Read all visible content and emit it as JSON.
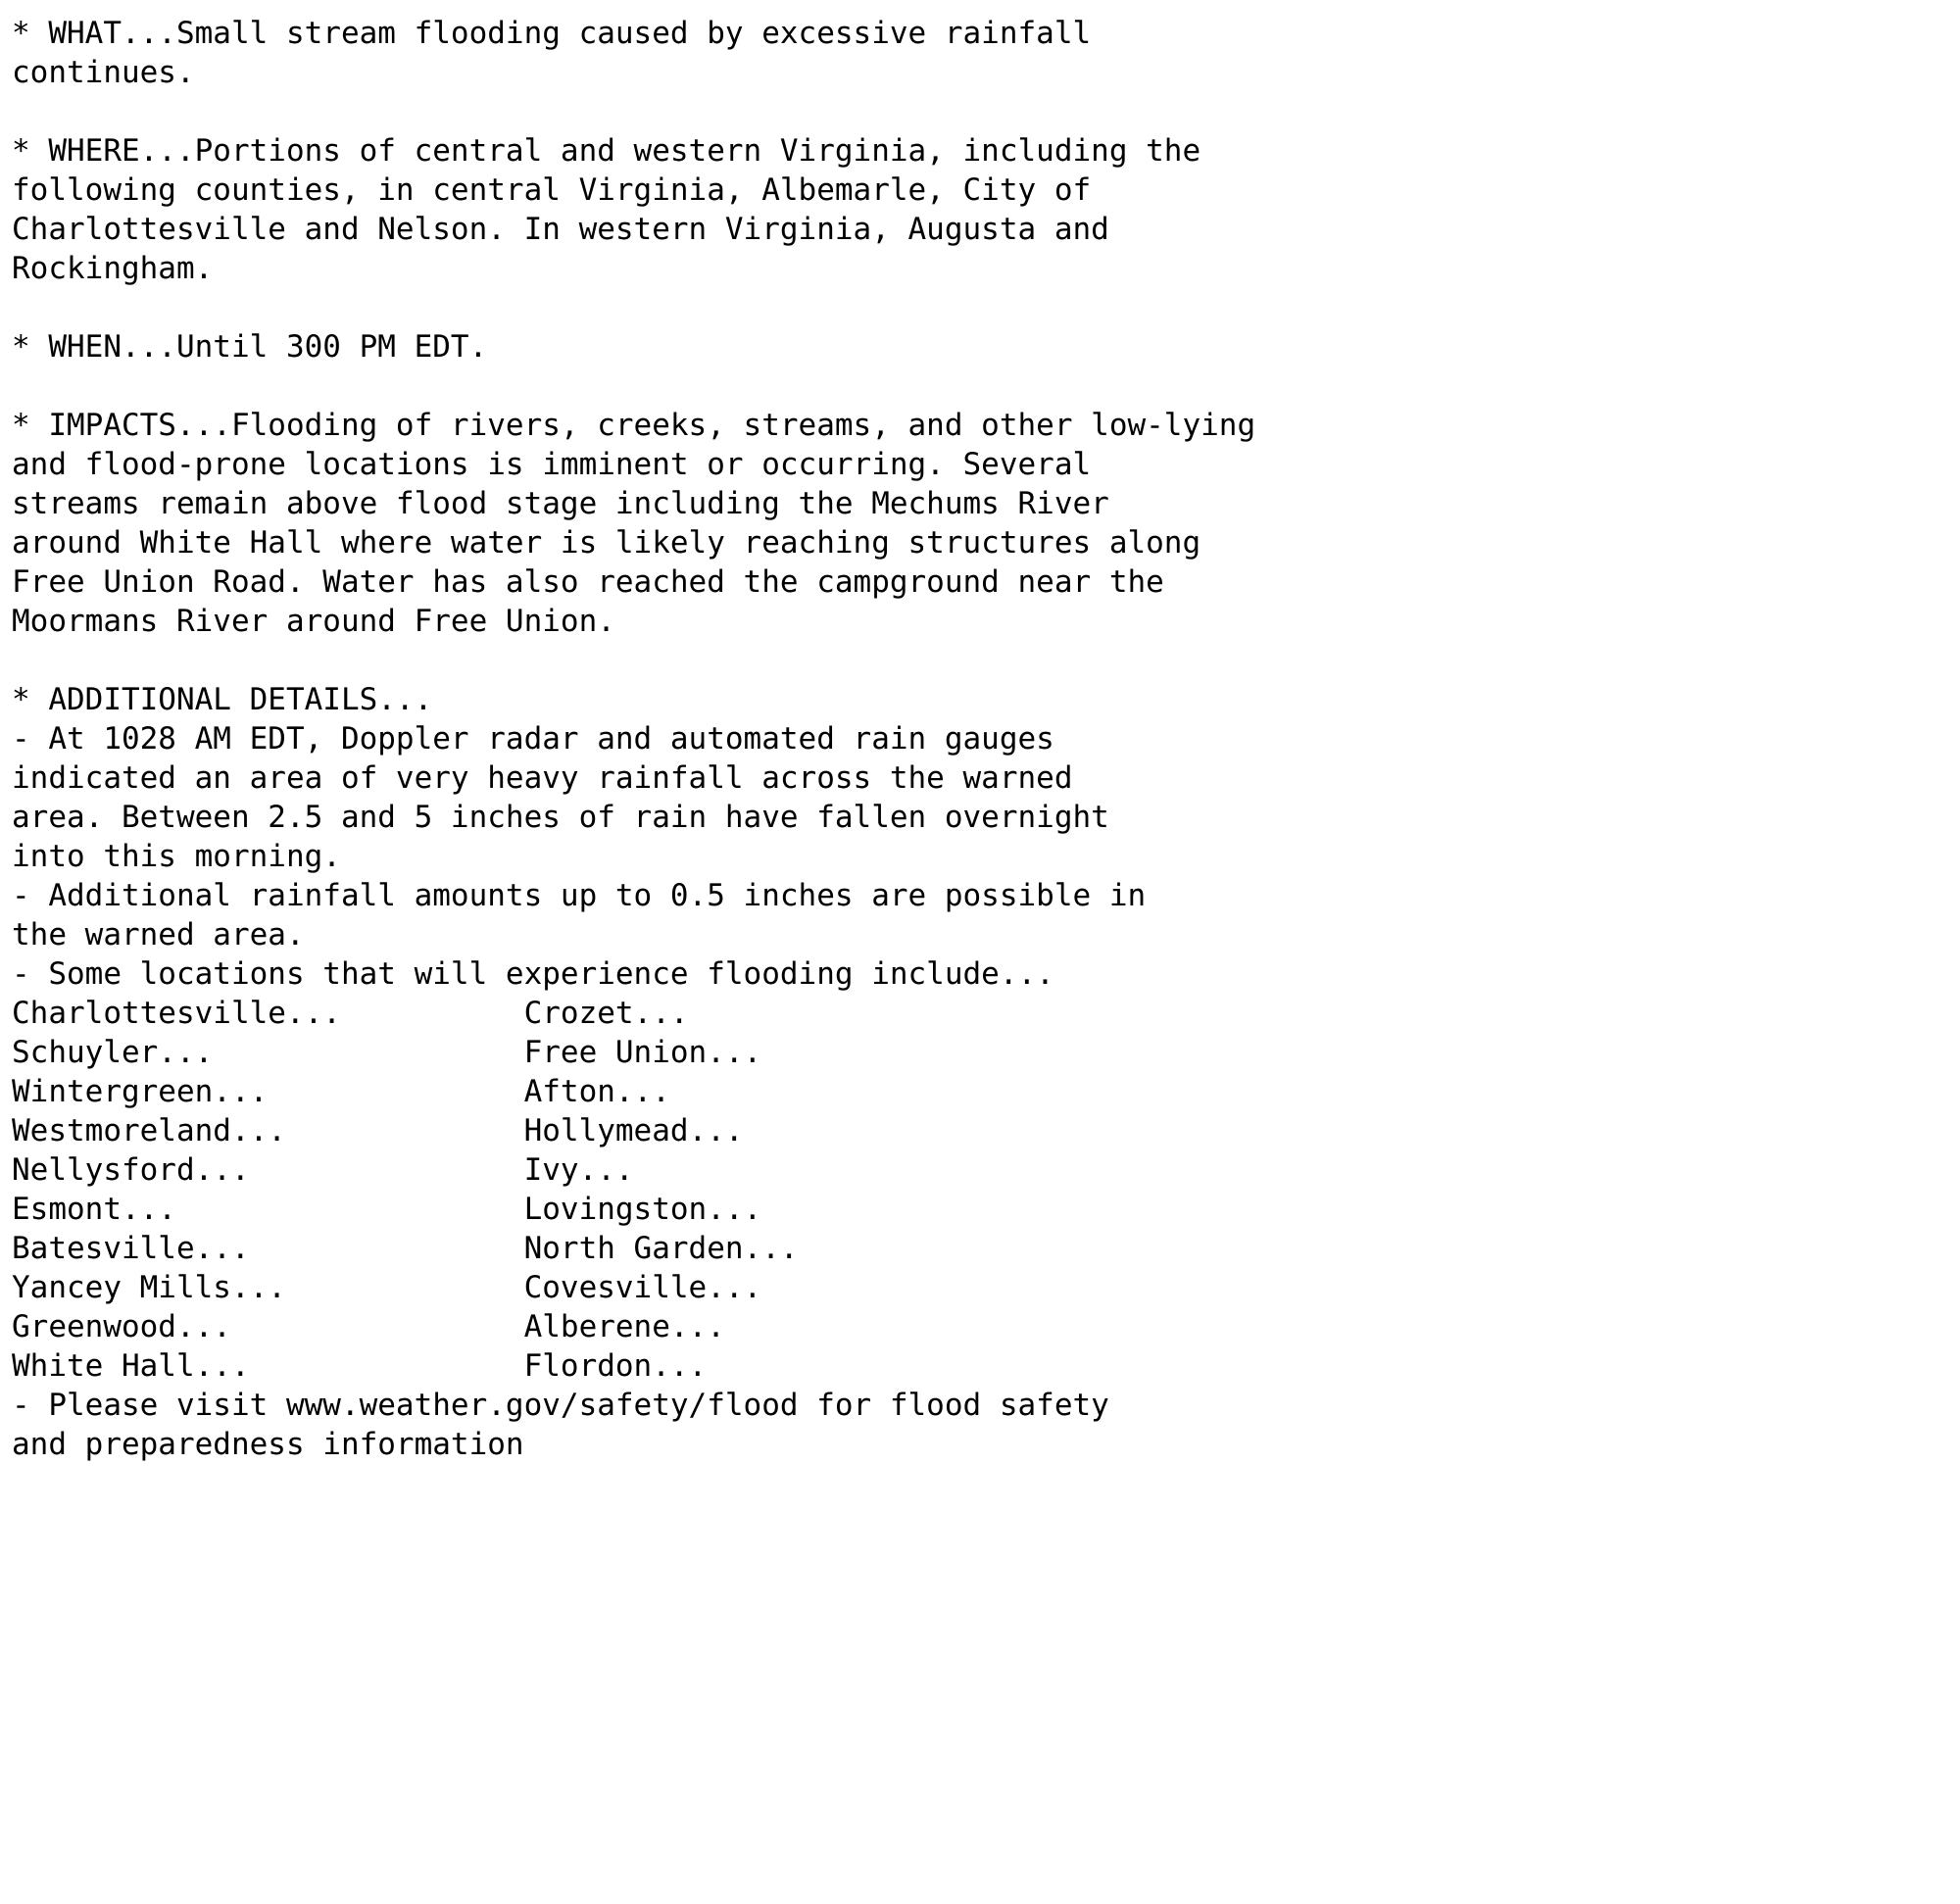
{
  "document": {
    "type": "nws-flood-warning-bulletin",
    "background_color": "#ffffff",
    "text_color": "#000000",
    "sections": {
      "what": {
        "label": "* WHAT...",
        "lines": [
          "* WHAT...Small stream flooding caused by excessive rainfall",
          "continues."
        ]
      },
      "where": {
        "label": "* WHERE...",
        "lines": [
          "* WHERE...Portions of central and western Virginia, including the",
          "following counties, in central Virginia, Albemarle, City of",
          "Charlottesville and Nelson. In western Virginia, Augusta and",
          "Rockingham."
        ]
      },
      "when": {
        "label": "* WHEN...",
        "lines": [
          "* WHEN...Until 300 PM EDT."
        ]
      },
      "impacts": {
        "label": "* IMPACTS...",
        "lines": [
          "* IMPACTS...Flooding of rivers, creeks, streams, and other low-lying",
          "and flood-prone locations is imminent or occurring. Several",
          "streams remain above flood stage including the Mechums River",
          "around White Hall where water is likely reaching structures along",
          "Free Union Road. Water has also reached the campground near the",
          "Moormans River around Free Union."
        ]
      },
      "additional_details": {
        "label": "* ADDITIONAL DETAILS...",
        "lines": [
          "* ADDITIONAL DETAILS...",
          "- At 1028 AM EDT, Doppler radar and automated rain gauges",
          "indicated an area of very heavy rainfall across the warned",
          "area. Between 2.5 and 5 inches of rain have fallen overnight",
          "into this morning.",
          "- Additional rainfall amounts up to 0.5 inches are possible in",
          "the warned area.",
          "- Some locations that will experience flooding include..."
        ]
      },
      "locations": {
        "column_left": [
          "Charlottesville...",
          "Schuyler...",
          "Wintergreen...",
          "Westmoreland...",
          "Nellysford...",
          "Esmont...",
          "Batesville...",
          "Yancey Mills...",
          "Greenwood...",
          "White Hall..."
        ],
        "column_right": [
          "Crozet...",
          "Free Union...",
          "Afton...",
          "Hollymead...",
          "Ivy...",
          "Lovingston...",
          "North Garden...",
          "Covesville...",
          "Alberene...",
          "Flordon..."
        ]
      },
      "safety": {
        "url": "www.weather.gov/safety/flood",
        "lines": [
          "- Please visit www.weather.gov/safety/flood for flood safety",
          "and preparedness information"
        ]
      }
    },
    "rendered_lines": [
      "* WHAT...Small stream flooding caused by excessive rainfall",
      "continues.",
      "",
      "* WHERE...Portions of central and western Virginia, including the",
      "following counties, in central Virginia, Albemarle, City of",
      "Charlottesville and Nelson. In western Virginia, Augusta and",
      "Rockingham.",
      "",
      "* WHEN...Until 300 PM EDT.",
      "",
      "* IMPACTS...Flooding of rivers, creeks, streams, and other low-lying",
      "and flood-prone locations is imminent or occurring. Several",
      "streams remain above flood stage including the Mechums River",
      "around White Hall where water is likely reaching structures along",
      "Free Union Road. Water has also reached the campground near the",
      "Moormans River around Free Union.",
      "",
      "* ADDITIONAL DETAILS...",
      "- At 1028 AM EDT, Doppler radar and automated rain gauges",
      "indicated an area of very heavy rainfall across the warned",
      "area. Between 2.5 and 5 inches of rain have fallen overnight",
      "into this morning.",
      "- Additional rainfall amounts up to 0.5 inches are possible in",
      "the warned area.",
      "- Some locations that will experience flooding include...",
      "Charlottesville...          Crozet...",
      "Schuyler...                 Free Union...",
      "Wintergreen...              Afton...",
      "Westmoreland...             Hollymead...",
      "Nellysford...               Ivy...",
      "Esmont...                   Lovingston...",
      "Batesville...               North Garden...",
      "Yancey Mills...             Covesville...",
      "Greenwood...                Alberene...",
      "White Hall...               Flordon...",
      "- Please visit www.weather.gov/safety/flood for flood safety",
      "and preparedness information"
    ]
  }
}
